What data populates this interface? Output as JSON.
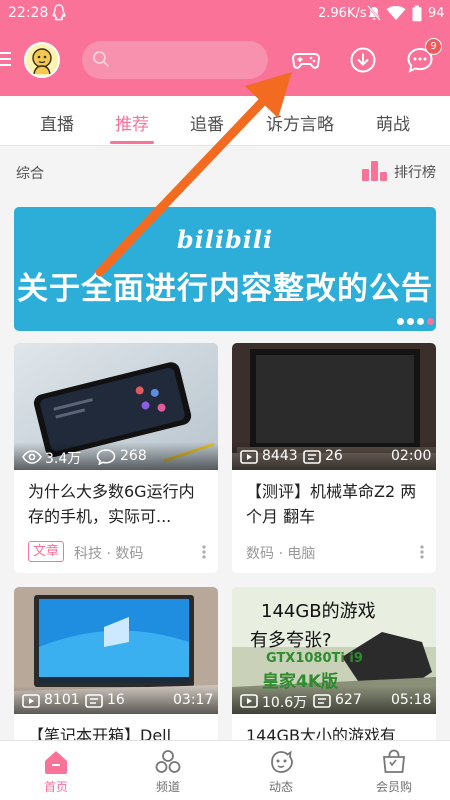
{
  "status_bar": {
    "time": "22:28",
    "network_speed": "2.96K/s",
    "battery": "94"
  },
  "header": {
    "search_placeholder": "",
    "message_badge": "9"
  },
  "tabs": [
    {
      "label": "直播"
    },
    {
      "label": "推荐"
    },
    {
      "label": "追番"
    },
    {
      "label": "诉方言略"
    },
    {
      "label": "萌战"
    }
  ],
  "active_tab": "推荐",
  "section": {
    "title": "综合",
    "rank_label": "排行榜"
  },
  "banner": {
    "logo": "bilibili",
    "title": "关于全面进行内容整改的公告",
    "slides": 4,
    "active_slide": 4
  },
  "cards": [
    {
      "views": "3.4万",
      "comments": "268",
      "duration": "",
      "title": "为什么大多数6G运行内存的手机，实际可...",
      "tag": "文章",
      "category": "科技 · 数码"
    },
    {
      "views": "8443",
      "comments": "26",
      "duration": "02:00",
      "title": "【测评】机械革命Z2 两个月 翻车",
      "tag": "",
      "category": "数码 · 电脑"
    },
    {
      "views": "8101",
      "comments": "16",
      "duration": "03:17",
      "title": "【笔记本开箱】Dell",
      "tag": "",
      "category": ""
    },
    {
      "views": "10.6万",
      "comments": "627",
      "duration": "05:18",
      "title": "144GB大小的游戏有",
      "tag": "",
      "category": ""
    }
  ],
  "thumb4_text": {
    "line1": "144GB的游戏",
    "line2": "有多夸张?",
    "line3": "GTX1080Ti i9",
    "line4": "皇家4K版"
  },
  "bottom_nav": [
    {
      "label": "首页"
    },
    {
      "label": "频道"
    },
    {
      "label": "动态"
    },
    {
      "label": "会员购"
    }
  ],
  "colors": {
    "brand_pink": "#fb7299",
    "banner_blue": "#2daed9",
    "annotation_arrow": "#f36b21"
  },
  "icons": [
    "qq-icon",
    "mute-icon",
    "wifi-icon",
    "battery-icon",
    "menu-icon",
    "avatar",
    "search-icon",
    "game-icon",
    "download-icon",
    "message-icon",
    "rank-icon",
    "play-icon",
    "comment-icon",
    "eye-icon",
    "home-icon",
    "channel-icon",
    "dynamic-icon",
    "shop-icon",
    "more-icon"
  ]
}
